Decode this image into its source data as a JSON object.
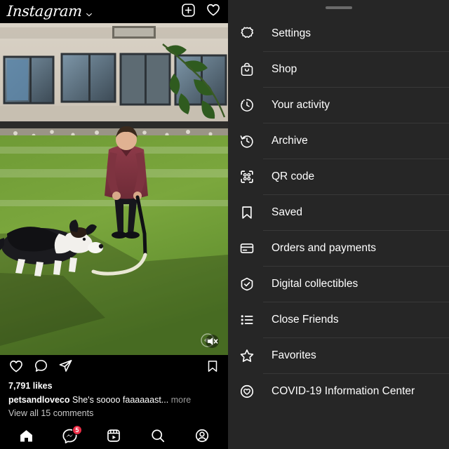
{
  "app": {
    "brand_name": "Instagram",
    "brand_chevron_icon": "chevron-down-icon",
    "add_icon": "plus-box-icon",
    "activity_icon": "heart-icon"
  },
  "post": {
    "media_type": "video",
    "media_description": "Man in maroon polo shirt playing with a black-and-white border collie on a green lawn in front of an office building",
    "mute_icon": "speaker-mute-icon",
    "like_icon": "heart-icon",
    "comment_icon": "comment-bubble-icon",
    "share_icon": "paper-plane-icon",
    "save_icon": "bookmark-icon",
    "likes_text": "7,791 likes",
    "caption_username": "petsandloveco",
    "caption_text": "She's soooo faaaaaast...",
    "caption_more": "more",
    "view_comments_text": "View all 15 comments"
  },
  "bottom_nav": {
    "items": [
      {
        "name": "home",
        "icon": "home-icon",
        "badge": ""
      },
      {
        "name": "messages",
        "icon": "messenger-icon",
        "badge": "5"
      },
      {
        "name": "reels",
        "icon": "reels-icon",
        "badge": ""
      },
      {
        "name": "search",
        "icon": "search-icon",
        "badge": ""
      },
      {
        "name": "profile",
        "icon": "profile-circle-icon",
        "badge": ""
      }
    ],
    "badge_color": "#ed2e47"
  },
  "side_panel": {
    "grabber_icon": "drag-handle",
    "background_color": "#262626",
    "items": [
      {
        "label": "Settings",
        "icon": "gear-icon"
      },
      {
        "label": "Shop",
        "icon": "shopping-bag-icon"
      },
      {
        "label": "Your activity",
        "icon": "activity-clock-icon"
      },
      {
        "label": "Archive",
        "icon": "archive-history-icon"
      },
      {
        "label": "QR code",
        "icon": "qr-code-icon"
      },
      {
        "label": "Saved",
        "icon": "bookmark-icon"
      },
      {
        "label": "Orders and payments",
        "icon": "credit-card-icon"
      },
      {
        "label": "Digital collectibles",
        "icon": "shield-check-icon"
      },
      {
        "label": "Close Friends",
        "icon": "list-icon"
      },
      {
        "label": "Favorites",
        "icon": "star-icon"
      },
      {
        "label": "COVID-19 Information Center",
        "icon": "heart-circle-icon"
      }
    ]
  }
}
